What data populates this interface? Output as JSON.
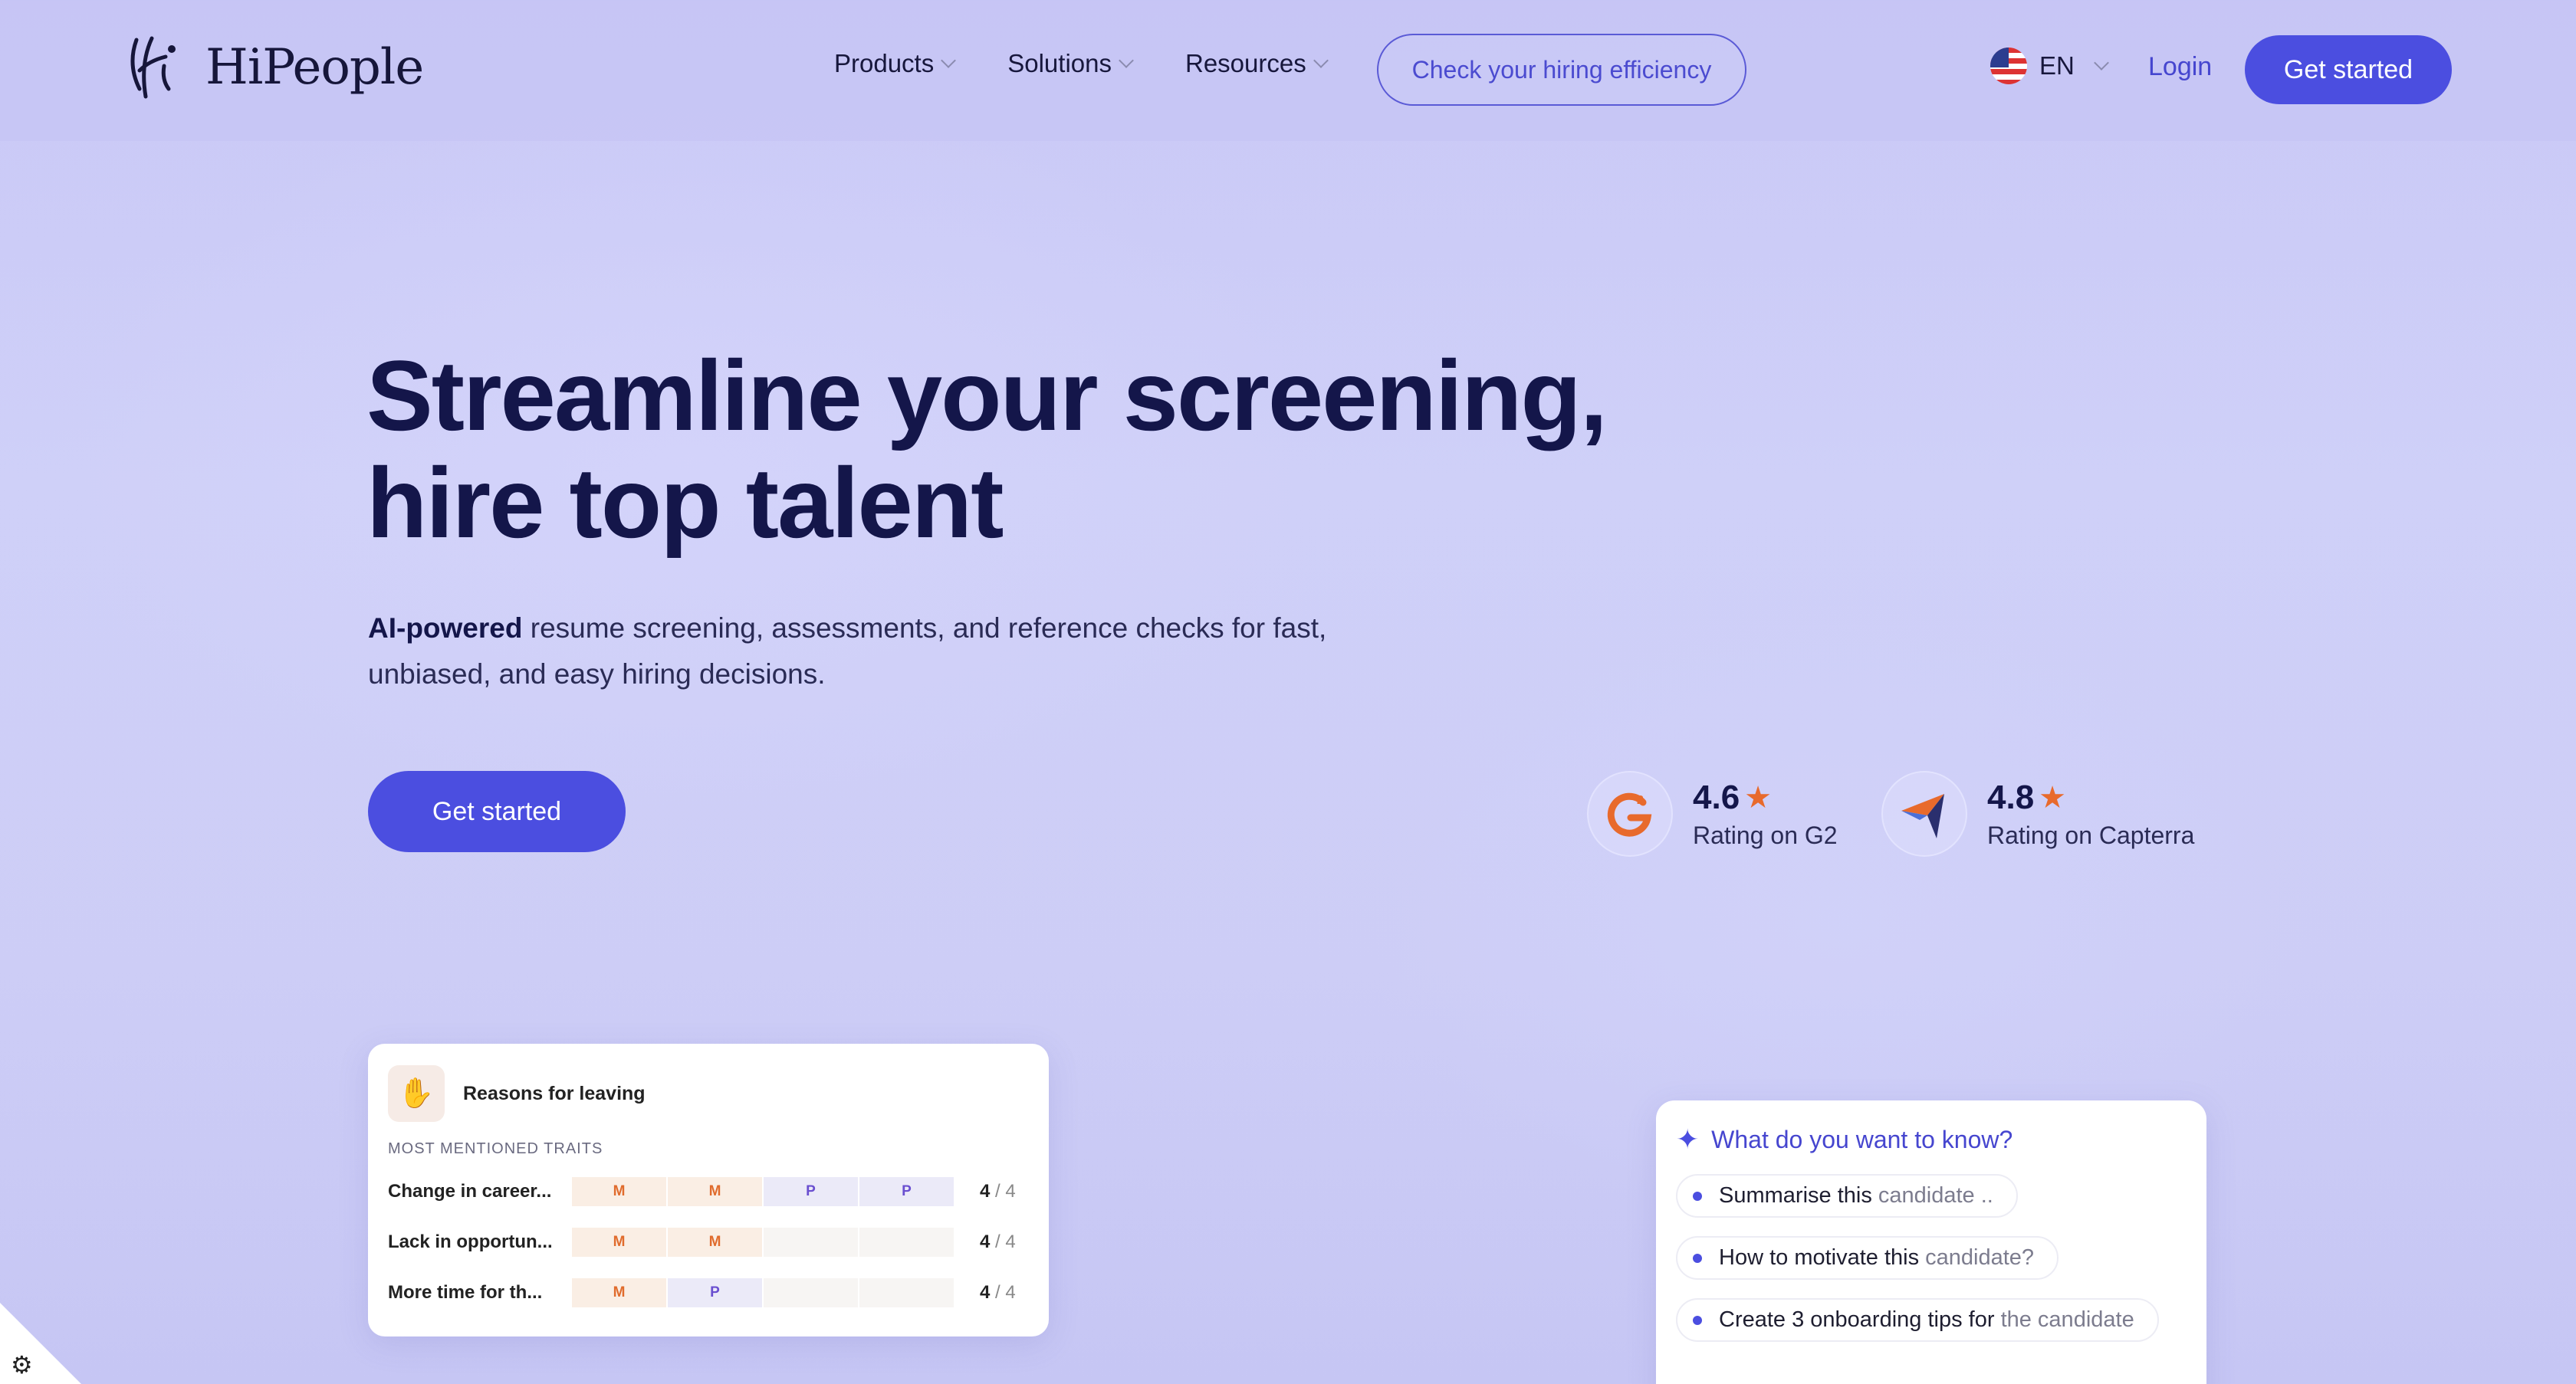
{
  "nav": {
    "brand": "HiPeople",
    "links": [
      {
        "label": "Products"
      },
      {
        "label": "Solutions"
      },
      {
        "label": "Resources"
      }
    ],
    "highlight_link": "Check your hiring efficiency",
    "language": "EN",
    "login": "Login",
    "cta": "Get started"
  },
  "hero": {
    "title_line1": "Streamline your screening,",
    "title_line2": "hire top talent",
    "subtitle_strong": "AI-powered",
    "subtitle_rest": " resume screening, assessments, and reference checks for fast, unbiased, and easy hiring decisions.",
    "cta": "Get started"
  },
  "ratings": [
    {
      "score": "4.6",
      "label": "Rating on G2",
      "icon": "g2-icon"
    },
    {
      "score": "4.8",
      "label": "Rating on Capterra",
      "icon": "capterra-icon"
    }
  ],
  "reasons_card": {
    "title": "Reasons for leaving",
    "traits_label": "MOST MENTIONED TRAITS",
    "rows": [
      {
        "name": "Change in career...",
        "segments": [
          "M",
          "M",
          "P",
          "P"
        ],
        "score": "4",
        "total": "4"
      },
      {
        "name": "Lack in opportun...",
        "segments": [
          "M",
          "M",
          "",
          ""
        ],
        "score": "4",
        "total": "4"
      },
      {
        "name": "More time for th...",
        "segments": [
          "M",
          "P",
          "",
          ""
        ],
        "score": "4",
        "total": "4"
      }
    ]
  },
  "ask_card": {
    "title": "What do you want to know?",
    "chips": [
      {
        "main": "Summarise this ",
        "fade": "candidate .."
      },
      {
        "main": "How to motivate this ",
        "fade": "candidate?"
      },
      {
        "main": "Create 3 onboarding tips for ",
        "fade": "the candidate"
      }
    ]
  },
  "colors": {
    "accent": "#4b4ee0",
    "star": "#e86a2c",
    "background": "#cfd0f8"
  }
}
